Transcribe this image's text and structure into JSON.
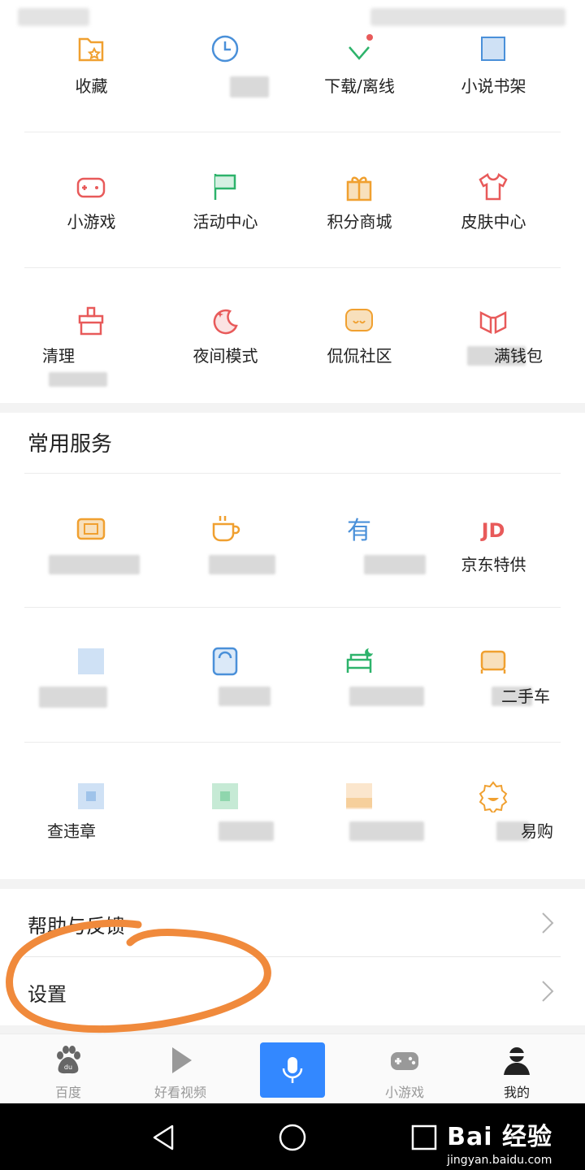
{
  "my_grid": [
    {
      "id": "favorites",
      "label": "收藏",
      "icon": "favorites-folder-icon",
      "color": "#f0a030"
    },
    {
      "id": "history",
      "label": "",
      "icon": "clock-icon",
      "color": "#4a90d9"
    },
    {
      "id": "download",
      "label": "下载/离线",
      "icon": "download-icon",
      "color": "#2db36b"
    },
    {
      "id": "novel_shelf",
      "label": "小说书架",
      "icon": "bookshelf-icon",
      "color": "#4a90d9"
    },
    {
      "id": "mini_games",
      "label": "小游戏",
      "icon": "gamepad-icon",
      "color": "#e85a5a"
    },
    {
      "id": "activity_center",
      "label": "活动中心",
      "icon": "flag-icon",
      "color": "#2db36b"
    },
    {
      "id": "points_mall",
      "label": "积分商城",
      "icon": "gift-icon",
      "color": "#f0a030"
    },
    {
      "id": "skin_center",
      "label": "皮肤中心",
      "icon": "tshirt-icon",
      "color": "#e85a5a"
    },
    {
      "id": "cleanup",
      "label": "清理",
      "icon": "broom-icon",
      "color": "#e85a5a"
    },
    {
      "id": "night_mode",
      "label": "夜间模式",
      "icon": "moon-icon",
      "color": "#e85a5a"
    },
    {
      "id": "community",
      "label": "侃侃社区",
      "icon": "chat-icon",
      "color": "#f0a030"
    },
    {
      "id": "wallet",
      "label": "满钱包",
      "icon": "wallet-icon",
      "color": "#e85a5a"
    }
  ],
  "common_services": {
    "title": "常用服务",
    "items": [
      {
        "id": "svc_1",
        "label": "",
        "icon": "ticket-icon",
        "color": "#f0a030"
      },
      {
        "id": "svc_2",
        "label": "",
        "icon": "coffee-icon",
        "color": "#f0a030"
      },
      {
        "id": "svc_3",
        "label": "",
        "icon": "you-character-icon",
        "color": "#4a90d9"
      },
      {
        "id": "jd",
        "label": "京东特供",
        "icon": "jd-logo-icon",
        "color": "#e85a5a"
      },
      {
        "id": "svc_5",
        "label": "",
        "icon": "blurred-icon",
        "color": "#4a90d9"
      },
      {
        "id": "svc_6",
        "label": "",
        "icon": "scale-icon",
        "color": "#4a90d9"
      },
      {
        "id": "svc_7",
        "label": "",
        "icon": "bed-icon",
        "color": "#2db36b"
      },
      {
        "id": "used_car",
        "label": "二手车",
        "icon": "car-icon",
        "color": "#f0a030"
      },
      {
        "id": "svc_9",
        "label": "查违章",
        "icon": "blurred-icon",
        "color": "#4a90d9"
      },
      {
        "id": "svc_10",
        "label": "",
        "icon": "blurred-icon",
        "color": "#2db36b"
      },
      {
        "id": "svc_11",
        "label": "",
        "icon": "blurred-icon",
        "color": "#f0a030"
      },
      {
        "id": "svc_12",
        "label": "易购",
        "icon": "badge-icon",
        "color": "#f0a030"
      }
    ]
  },
  "menu": {
    "help": "帮助与反馈",
    "settings": "设置"
  },
  "tabbar": [
    {
      "id": "baidu",
      "label": "百度",
      "icon": "baidu-paw-icon"
    },
    {
      "id": "videos",
      "label": "好看视频",
      "icon": "play-icon"
    },
    {
      "id": "voice",
      "label": "",
      "icon": "microphone-icon"
    },
    {
      "id": "games",
      "label": "小游戏",
      "icon": "gamepad-icon"
    },
    {
      "id": "me",
      "label": "我的",
      "icon": "user-icon"
    }
  ],
  "watermark": {
    "main": "Bai 经验",
    "sub": "jingyan.baidu.com"
  },
  "colors": {
    "accent_blue": "#3388ff",
    "annotation_orange": "#f08a3c"
  }
}
